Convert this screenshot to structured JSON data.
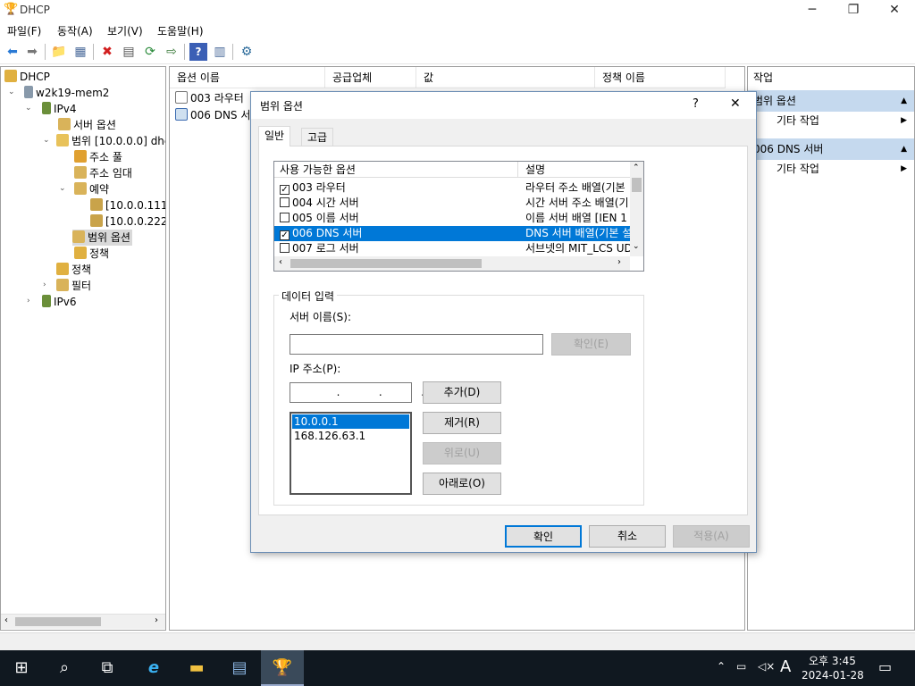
{
  "window": {
    "title": "DHCP"
  },
  "menus": [
    "파일(F)",
    "동작(A)",
    "보기(V)",
    "도움말(H)"
  ],
  "tree": {
    "root": "DHCP",
    "server": "w2k19-mem2",
    "ipv4": "IPv4",
    "server_options": "서버 옵션",
    "scope": "범위 [10.0.0.0] dhc",
    "address_pool": "주소 풀",
    "address_leases": "주소 임대",
    "reservations": "예약",
    "res1": "[10.0.0.111]",
    "res2": "[10.0.0.222]",
    "scope_options": "범위 옵션",
    "scope_policies": "정책",
    "policies": "정책",
    "filters": "필터",
    "ipv6": "IPv6"
  },
  "list": {
    "columns": [
      "옵션 이름",
      "공급업체",
      "값",
      "정책 이름"
    ],
    "rows": [
      "003 라우터",
      "006 DNS 서"
    ]
  },
  "actions": {
    "header": "작업",
    "section1": "범위 옵션",
    "more1": "기타 작업",
    "section2": "006 DNS 서버",
    "more2": "기타 작업"
  },
  "dialog": {
    "title": "범위 옵션",
    "help": "?",
    "close": "✕",
    "tabs": [
      "일반",
      "고급"
    ],
    "options_headers": [
      "사용 가능한 옵션",
      "설명"
    ],
    "options": [
      {
        "name": "003 라우터",
        "desc": "라우터 주소 배열(기본",
        "checked": true
      },
      {
        "name": "004 시간 서버",
        "desc": "시간 서버 주소 배열(기",
        "checked": false
      },
      {
        "name": "005 이름 서버",
        "desc": "이름 서버 배열 [IEN 1",
        "checked": false
      },
      {
        "name": "006 DNS 서버",
        "desc": "DNS 서버 배열(기본 설",
        "checked": true
      },
      {
        "name": "007 로그 서버",
        "desc": "서브넷의 MIT_LCS UD",
        "checked": false
      }
    ],
    "data_entry": "데이터 입력",
    "server_name_label": "서버 이름(S):",
    "resolve": "확인(E)",
    "ip_label": "IP 주소(P):",
    "ip_placeholder": "  .   .   .",
    "add": "추가(D)",
    "remove": "제거(R)",
    "up": "위로(U)",
    "down": "아래로(O)",
    "ips": [
      "10.0.0.1",
      "168.126.63.1"
    ],
    "ok": "확인",
    "cancel": "취소",
    "apply": "적용(A)"
  },
  "clock": {
    "time": "오후 3:45",
    "date": "2024-01-28"
  },
  "ime": "A"
}
